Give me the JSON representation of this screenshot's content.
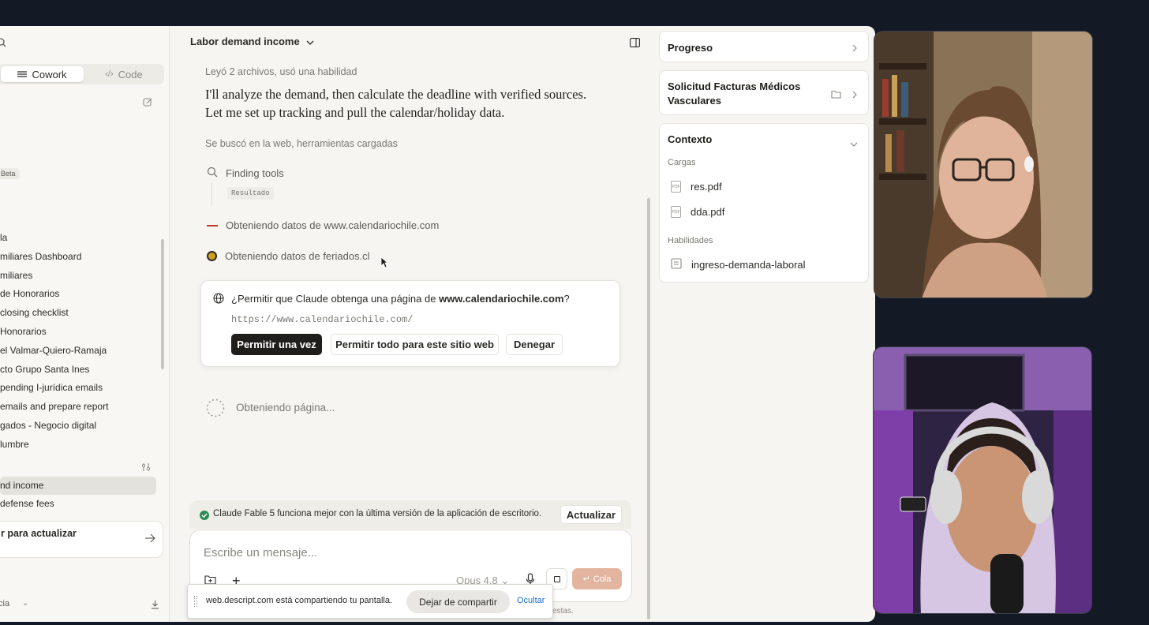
{
  "sidebar": {
    "tabs": [
      {
        "label": "Cowork"
      },
      {
        "label": "Code"
      }
    ],
    "beta": "Beta",
    "items": [
      "la",
      "miliares Dashboard",
      "miliares",
      "de Honorarios",
      "closing checklist",
      "Honorarios",
      "el Valmar-Quiero-Ramaja",
      "cto Grupo Santa Ines",
      "pending I-jurídica emails",
      " emails and prepare report",
      "gados - Negocio digital",
      "lumbre"
    ],
    "items2": [
      "nd income",
      " defense fees"
    ],
    "update_card": "r para actualizar",
    "footer_label": "cia"
  },
  "chat": {
    "title": "Labor demand income",
    "activity1": "Leyó 2 archivos, usó una habilidad",
    "message_line1": "I'll analyze the demand, then calculate the deadline with verified sources.",
    "message_line2": "Let me set up tracking and pull the calendar/holiday data.",
    "activity2": "Se buscó en la web, herramientas cargadas",
    "tool1": "Finding tools",
    "tool1_chip": "Resultado",
    "tool2": "Obteniendo datos de www.calendariochile.com",
    "tool3": "Obteniendo datos de feriados.cl",
    "permission": {
      "question_pre": "¿Permitir que Claude obtenga una página de ",
      "question_domain": "www.calendariochile.com",
      "question_post": "?",
      "url": "https://www.calendariochile.com/",
      "allow_once": "Permitir una vez",
      "allow_all": "Permitir todo para este sitio web",
      "deny": "Denegar"
    },
    "loading": "Obteniendo página...",
    "notice": "Claude Fable 5 funciona mejor con la última versión de la aplicación de escritorio.",
    "update_button": "Actualizar",
    "composer_placeholder": "Escribe un mensaje...",
    "model": "Opus 4.8",
    "queue": "Cola",
    "disclaimer_tail": "estas."
  },
  "share_bar": {
    "text": "web.descript.com está compartiendo tu pantalla.",
    "stop": "Dejar de compartir",
    "hide": "Ocultar"
  },
  "right_panel": {
    "progress": "Progreso",
    "folder_line1": "Solicitud Facturas Médicos",
    "folder_line2": "Vasculares",
    "context": "Contexto",
    "uploads_label": "Cargas",
    "files": [
      "res.pdf",
      "dda.pdf"
    ],
    "skills_label": "Habilidades",
    "skill": "ingreso-demanda-laboral"
  },
  "colors": {
    "accent_queue": "#e3b49f",
    "success": "#2e8b57",
    "link": "#1a6fd1"
  }
}
